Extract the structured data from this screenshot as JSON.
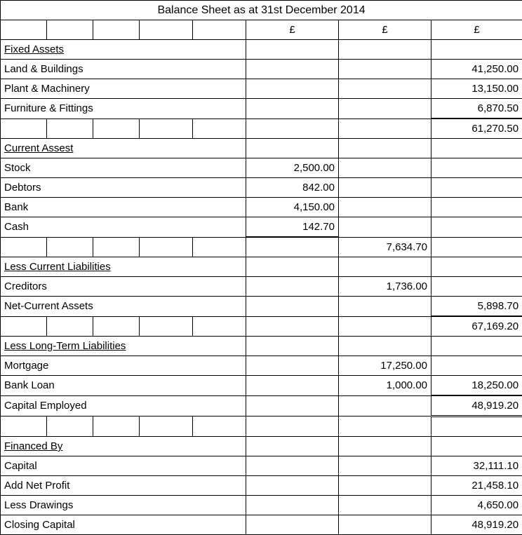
{
  "title": "Balance Sheet as at 31st December 2014",
  "currency": "£",
  "sections": {
    "fixed_assets": {
      "heading": "Fixed Assets",
      "land_buildings": {
        "label": "Land & Buildings",
        "value": "41,250.00"
      },
      "plant_machinery": {
        "label": "Plant & Machinery",
        "value": "13,150.00"
      },
      "furniture_fittings": {
        "label": "Furniture & Fittings",
        "value": "6,870.50"
      },
      "total": "61,270.50"
    },
    "current_assets": {
      "heading": "Current Assest",
      "stock": {
        "label": "Stock",
        "value": "2,500.00"
      },
      "debtors": {
        "label": "Debtors",
        "value": "842.00"
      },
      "bank": {
        "label": "Bank",
        "value": "4,150.00"
      },
      "cash": {
        "label": "Cash",
        "value": "142.70"
      },
      "total": "7,634.70"
    },
    "less_current_liabilities": {
      "heading": "Less Current Liabilities",
      "creditors": {
        "label": "Creditors",
        "value": "1,736.00"
      },
      "net_current_assets": {
        "label": "Net-Current Assets",
        "value": "5,898.70"
      },
      "running_total": "67,169.20"
    },
    "less_long_term": {
      "heading": "Less Long-Term Liabilities",
      "mortgage": {
        "label": "Mortgage",
        "value": "17,250.00"
      },
      "bank_loan": {
        "label": "Bank Loan",
        "value_g": "1,000.00",
        "value_h": "18,250.00"
      },
      "capital_employed": {
        "label": "Capital Employed",
        "value": "48,919.20"
      }
    },
    "financed_by": {
      "heading": "Financed By",
      "capital": {
        "label": "Capital",
        "value": "32,111.10"
      },
      "add_net_profit": {
        "label": "Add Net Profit",
        "value": "21,458.10"
      },
      "less_drawings": {
        "label": "Less Drawings",
        "value": "4,650.00"
      },
      "closing_capital": {
        "label": "Closing Capital",
        "value": "48,919.20"
      }
    }
  }
}
